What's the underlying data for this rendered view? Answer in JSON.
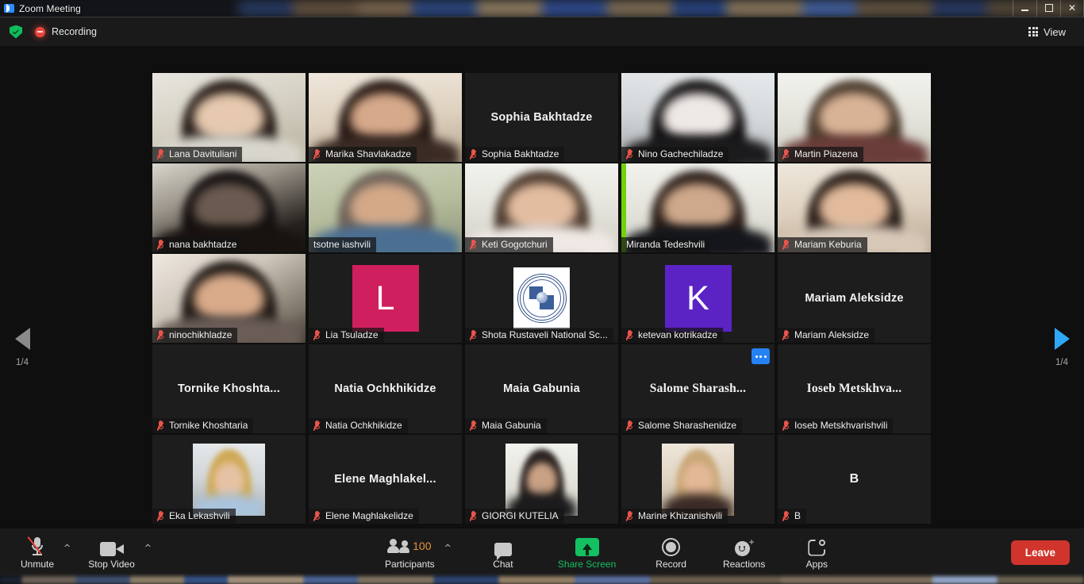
{
  "window": {
    "title": "Zoom Meeting",
    "app_icon": "zoom-camera-icon",
    "minimize_label": "Minimize",
    "maximize_label": "Restore",
    "close_label": "✕"
  },
  "topbar": {
    "encryption_icon": "shield-check-icon",
    "recording_icon": "recording-dot-icon",
    "recording_label": "Recording",
    "view_icon": "grid-icon",
    "view_label": "View"
  },
  "pager": {
    "prev_icon": "left-triangle-icon",
    "prev_label": "1/4",
    "next_icon": "right-triangle-icon",
    "next_label": "1/4",
    "prev_color": "#8a8a8a",
    "next_color": "#2fa8f5"
  },
  "gallery": {
    "active_speaker_color": "#cfe84a",
    "participants": [
      {
        "name": "Lana Davituliani",
        "type": "video",
        "video": "v-room",
        "muted": true,
        "skin": "#e6c9ae",
        "hair": "#241a16",
        "shirt": "#d8d6cc"
      },
      {
        "name": "Marika Shavlakadze",
        "type": "video",
        "video": "v-warm",
        "muted": true,
        "skin": "#d6a98a",
        "hair": "#241712",
        "shirt": "#3a2b24"
      },
      {
        "name": "Sophia Bakhtadze",
        "type": "name",
        "display": "Sophia Bakhtadze",
        "muted": true
      },
      {
        "name": "Nino Gachechiladze",
        "type": "video",
        "video": "v-cool",
        "muted": true,
        "skin": "#efe9e6",
        "hair": "#120f10",
        "shirt": "#1b1a1c"
      },
      {
        "name": "Martin Piazena",
        "type": "video",
        "video": "v-bright",
        "muted": true,
        "skin": "#d9b396",
        "hair": "#4a3a2c",
        "shirt": "#6b3d3a"
      },
      {
        "name": "nana bakhtadze",
        "type": "video",
        "video": "v-dark",
        "muted": true,
        "skin": "#6a5a50",
        "hair": "#141010",
        "shirt": "#181310"
      },
      {
        "name": "tsotne iashvili",
        "type": "video",
        "video": "v-green",
        "muted": false,
        "skin": "#d3a988",
        "hair": "#6d6259",
        "shirt": "#4a6f93"
      },
      {
        "name": "Keti Gogotchuri",
        "type": "video",
        "video": "v-bright",
        "muted": true,
        "skin": "#e3bda0",
        "hair": "#4a382c",
        "shirt": "#efe8e4"
      },
      {
        "name": "Miranda Tedeshvili",
        "type": "video",
        "video": "v-bright",
        "muted": false,
        "speaking": true,
        "skin": "#cfa98c",
        "hair": "#2a1d17",
        "shirt": "#14161b"
      },
      {
        "name": "Mariam Keburia",
        "type": "video",
        "video": "v-warm",
        "muted": true,
        "skin": "#e2bb9c",
        "hair": "#241a15",
        "shirt": "#d8c8b8"
      },
      {
        "name": "ninochikhladze",
        "type": "video",
        "video": "v-blur",
        "muted": true,
        "skin": "#d9ab8a",
        "hair": "#1d1713",
        "shirt": "#6a5d57"
      },
      {
        "name": "Lia Tsuladze",
        "type": "avatar",
        "initial": "L",
        "color": "#d01f5e",
        "muted": true
      },
      {
        "name": "Shota Rustaveli National Sc...",
        "type": "logo",
        "logo": "shota-rustaveli-seal-icon",
        "muted": true
      },
      {
        "name": "ketevan kotrikadze",
        "type": "avatar",
        "initial": "K",
        "color": "#5b23c4",
        "muted": true
      },
      {
        "name": "Mariam Aleksidze",
        "type": "name",
        "display": "Mariam Aleksidze",
        "muted": true
      },
      {
        "name": "Tornike Khoshtaria",
        "type": "name",
        "display": "Tornike  Khoshta...",
        "muted": true
      },
      {
        "name": "Natia Ochkhikidze",
        "type": "name",
        "display": "Natia Ochkhikidze",
        "muted": true
      },
      {
        "name": "Maia Gabunia",
        "type": "name",
        "display": "Maia Gabunia",
        "muted": true
      },
      {
        "name": "Salome Sharashenidze",
        "type": "name",
        "display": "Salome  Sharash...",
        "muted": true,
        "serif": true,
        "more": true,
        "more_icon": "more-options-icon"
      },
      {
        "name": "Ioseb Metskhvarishvili",
        "type": "name",
        "display": "Ioseb  Metskhva...",
        "muted": true,
        "serif": true
      },
      {
        "name": "Eka Lekashvili",
        "type": "photo",
        "video": "v-cool",
        "muted": true,
        "skin": "#e6c2a4",
        "hair": "#cfa956",
        "shirt": "#aac4de"
      },
      {
        "name": "Elene Maghlakelidze",
        "type": "name",
        "display": "Elene  Maghlakel...",
        "muted": true
      },
      {
        "name": "GIORGI KUTELIA",
        "type": "photo",
        "video": "v-bright",
        "muted": true,
        "skin": "#c9a184",
        "hair": "#2b2320",
        "shirt": "#1b1b1d"
      },
      {
        "name": "Marine Khizanishvili",
        "type": "photo",
        "video": "v-warm",
        "muted": true,
        "skin": "#e3b896",
        "hair": "#c9a878",
        "shirt": "#3a2a26"
      },
      {
        "name": "B",
        "type": "name",
        "display": "B",
        "muted": true,
        "initial_style": true
      }
    ]
  },
  "controls": [
    {
      "label": "Unmute",
      "icon": "microphone-muted-icon",
      "caret": true,
      "caret_icon": "chevron-up-icon"
    },
    {
      "label": "Stop Video",
      "icon": "video-camera-icon",
      "caret": true,
      "caret_icon": "chevron-up-icon"
    },
    {
      "label": "Participants",
      "icon": "participants-icon",
      "caret": true,
      "caret_icon": "chevron-up-icon",
      "count": "100",
      "count_color": "#e8933a"
    },
    {
      "label": "Chat",
      "icon": "chat-bubble-icon",
      "caret": false
    },
    {
      "label": "Share Screen",
      "icon": "share-screen-icon",
      "caret": false,
      "accent": "#13c062"
    },
    {
      "label": "Record",
      "icon": "record-circle-icon",
      "caret": false
    },
    {
      "label": "Reactions",
      "icon": "reactions-smiley-icon",
      "caret": false
    },
    {
      "label": "Apps",
      "icon": "apps-bracket-icon",
      "caret": false
    }
  ],
  "leave": {
    "label": "Leave",
    "color": "#d0342c"
  }
}
